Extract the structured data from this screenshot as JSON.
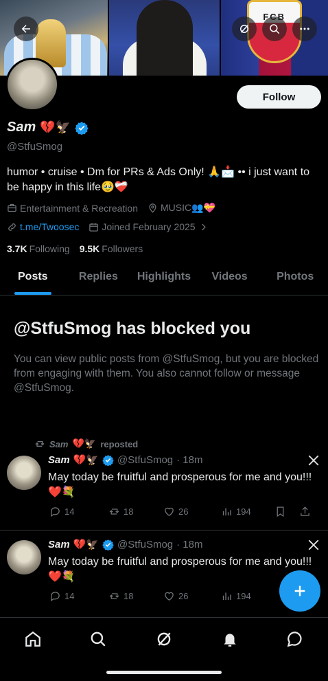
{
  "banner": {
    "crest_text": "FCB"
  },
  "profile": {
    "follow_label": "Follow",
    "name": "Sam",
    "name_emoji": "💔🦅",
    "handle": "@StfuSmog",
    "bio": "humor • cruise • Dm for PRs & Ads Only! 🙏📩 •• i just want to be happy in this life🥹❤️‍🩹",
    "category": "Entertainment & Recreation",
    "location": "MUSIC👥💝",
    "link": "t.me/Twoosec",
    "joined": "Joined February 2025",
    "following_count": "3.7K",
    "following_label": "Following",
    "followers_count": "9.5K",
    "followers_label": "Followers"
  },
  "tabs": [
    {
      "label": "Posts",
      "active": true
    },
    {
      "label": "Replies"
    },
    {
      "label": "Highlights"
    },
    {
      "label": "Videos"
    },
    {
      "label": "Photos"
    }
  ],
  "blocked": {
    "title": "@StfuSmog has blocked you",
    "description": "You can view public posts from @StfuSmog, but you are blocked from engaging with them. You also cannot follow or message @StfuSmog."
  },
  "repost_line": {
    "name": "Sam",
    "emoji": "💔🦅",
    "label": "reposted"
  },
  "posts": [
    {
      "name": "Sam",
      "emoji": "💔🦅",
      "handle": "@StfuSmog",
      "time": "· 18m",
      "text": "May today be fruitful and prosperous for me and you!!! ❤️💐",
      "replies": "14",
      "reposts": "18",
      "likes": "26",
      "views": "194"
    },
    {
      "name": "Sam",
      "emoji": "💔🦅",
      "handle": "@StfuSmog",
      "time": "· 18m",
      "text": "May today be fruitful and prosperous for me and you!!! ❤️💐",
      "replies": "14",
      "reposts": "18",
      "likes": "26",
      "views": "194"
    }
  ],
  "colors": {
    "accent": "#1d9bf0",
    "background": "#000000",
    "muted": "#71767b",
    "text": "#e7e9ea"
  },
  "icons": {
    "back": "back-arrow-icon",
    "grok": "grok-icon",
    "search": "search-icon",
    "more": "more-icon",
    "compose": "plus-icon",
    "nav": [
      "home-icon",
      "search-icon",
      "grok-icon",
      "bell-icon",
      "messages-icon"
    ]
  }
}
